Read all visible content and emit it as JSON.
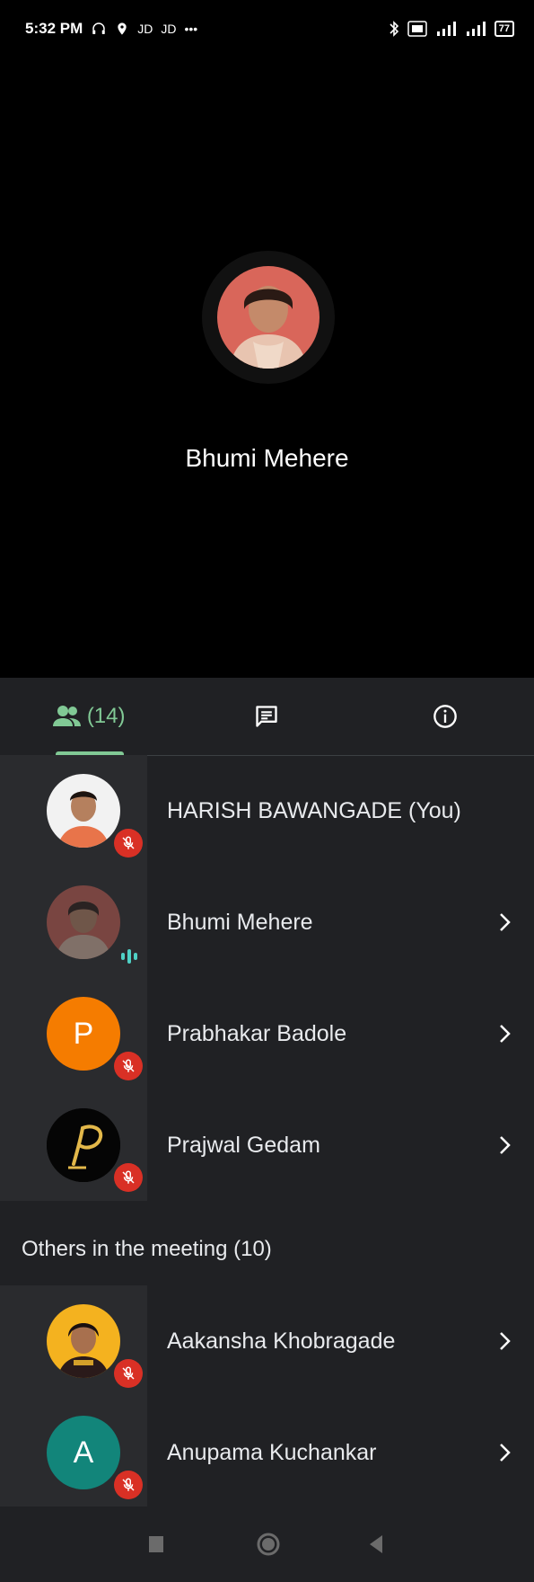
{
  "status_bar": {
    "time": "5:32 PM",
    "left_icons": [
      "headset-icon",
      "location-icon",
      "jio-icon",
      "jio-icon",
      "more-icon"
    ],
    "left_texts": [
      "JD",
      "JD",
      "•••"
    ],
    "right_icons": [
      "bluetooth-icon",
      "volte-icon",
      "signal-icon",
      "signal-icon",
      "battery-icon"
    ],
    "battery": "77"
  },
  "stage": {
    "speaker_name": "Bhumi Mehere"
  },
  "tabs": {
    "people_count": "(14)",
    "items": [
      "people-icon",
      "chat-icon",
      "info-icon"
    ]
  },
  "participants": [
    {
      "name": "HARISH BAWANGADE (You)",
      "avatar": "photo",
      "mic": "muted",
      "chevron": false
    },
    {
      "name": "Bhumi Mehere",
      "avatar": "photo",
      "mic": "speaking",
      "chevron": true
    },
    {
      "name": "Prabhakar Badole",
      "avatar": "letter",
      "letter": "P",
      "color": "#f57c00",
      "mic": "muted",
      "chevron": true
    },
    {
      "name": "Prajwal Gedam",
      "avatar": "logo",
      "mic": "muted",
      "chevron": true
    }
  ],
  "others": {
    "header": "Others in the meeting (10)",
    "participants": [
      {
        "name": "Aakansha Khobragade",
        "avatar": "photo",
        "mic": "muted",
        "chevron": true
      },
      {
        "name": "Anupama Kuchankar",
        "avatar": "letter",
        "letter": "A",
        "color": "#12857a",
        "mic": "muted",
        "chevron": true
      }
    ]
  },
  "nav_bar": {
    "buttons": [
      "recents-icon",
      "home-icon",
      "back-icon"
    ]
  },
  "colors": {
    "accent": "#81c995",
    "muted_red": "#d93025",
    "speaking": "#4fd1c5",
    "background": "#202124"
  }
}
